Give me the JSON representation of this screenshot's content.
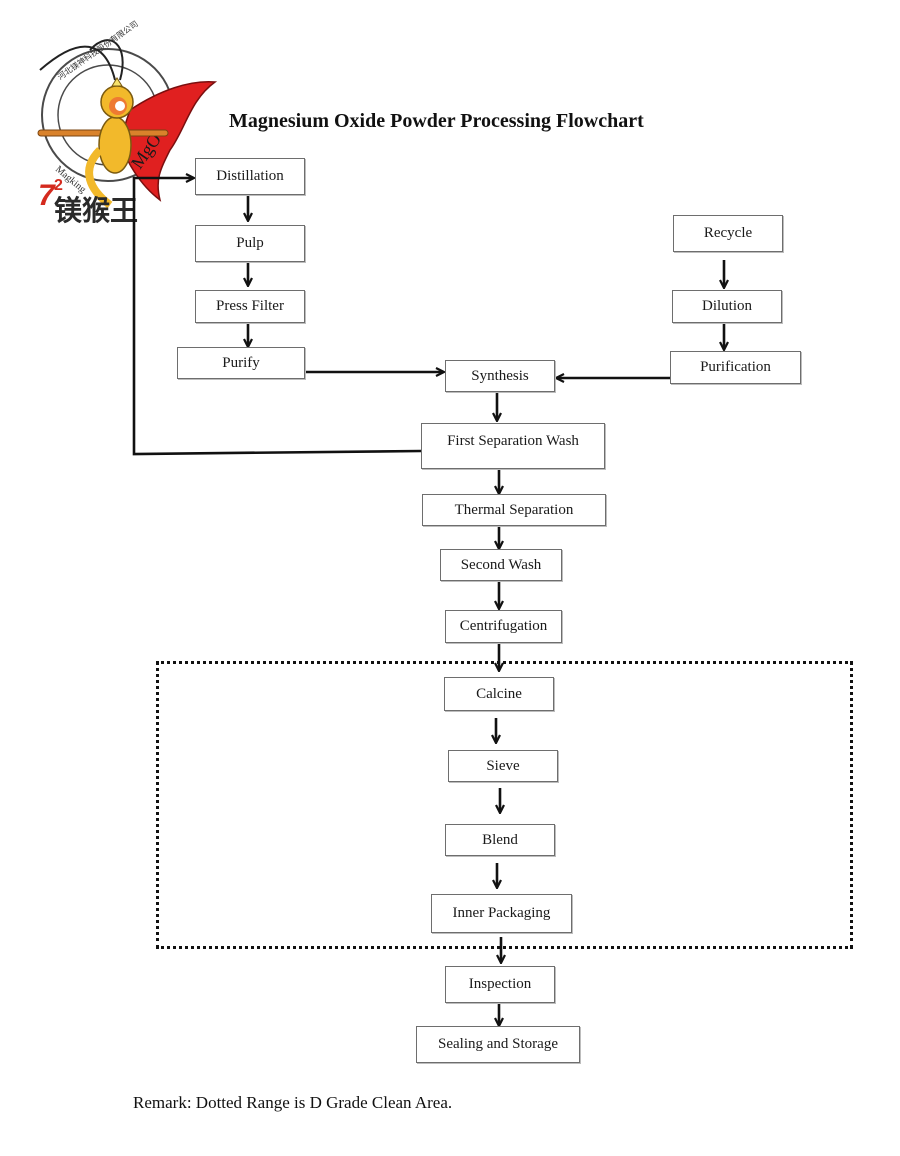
{
  "title": "Magnesium Oxide Powder Processing Flowchart",
  "remark": "Remark: Dotted Range is D Grade Clean Area.",
  "logo": {
    "icon": "monkey-king-logo-icon",
    "ring_text_cn": "河北镁神科技股份有限公司",
    "ring_text_en": "Magking",
    "cape_text": "MgO",
    "badge_number": "72",
    "brand_cn": "镁猴王",
    "colors": {
      "cape": "#e02020",
      "brand_red": "#d42a1e",
      "brand_dark": "#2a2a2a",
      "gold": "#f2b92b"
    }
  },
  "clean_area": {
    "label": "D Grade Clean Area",
    "style": "dotted"
  },
  "nodes": [
    {
      "id": "distillation",
      "label": "Distillation"
    },
    {
      "id": "pulp",
      "label": "Pulp"
    },
    {
      "id": "press_filter",
      "label": "Press Filter"
    },
    {
      "id": "purify",
      "label": "Purify"
    },
    {
      "id": "recycle",
      "label": "Recycle"
    },
    {
      "id": "dilution",
      "label": "Dilution"
    },
    {
      "id": "purification",
      "label": "Purification"
    },
    {
      "id": "synthesis",
      "label": "Synthesis"
    },
    {
      "id": "first_separation_wash",
      "label": "First Separation Wash"
    },
    {
      "id": "thermal_separation",
      "label": "Thermal Separation"
    },
    {
      "id": "second_wash",
      "label": "Second Wash"
    },
    {
      "id": "centrifugation",
      "label": "Centrifugation"
    },
    {
      "id": "calcine",
      "label": "Calcine"
    },
    {
      "id": "sieve",
      "label": "Sieve"
    },
    {
      "id": "blend",
      "label": "Blend"
    },
    {
      "id": "inner_packaging",
      "label": "Inner Packaging"
    },
    {
      "id": "inspection",
      "label": "Inspection"
    },
    {
      "id": "sealing_and_storage",
      "label": "Sealing and Storage"
    }
  ],
  "edges": [
    {
      "from": "distillation",
      "to": "pulp"
    },
    {
      "from": "pulp",
      "to": "press_filter"
    },
    {
      "from": "press_filter",
      "to": "purify"
    },
    {
      "from": "purify",
      "to": "synthesis"
    },
    {
      "from": "recycle",
      "to": "dilution"
    },
    {
      "from": "dilution",
      "to": "purification"
    },
    {
      "from": "purification",
      "to": "synthesis"
    },
    {
      "from": "synthesis",
      "to": "first_separation_wash"
    },
    {
      "from": "first_separation_wash",
      "to": "distillation",
      "type": "feedback-loop"
    },
    {
      "from": "first_separation_wash",
      "to": "thermal_separation"
    },
    {
      "from": "thermal_separation",
      "to": "second_wash"
    },
    {
      "from": "second_wash",
      "to": "centrifugation"
    },
    {
      "from": "centrifugation",
      "to": "calcine"
    },
    {
      "from": "calcine",
      "to": "sieve"
    },
    {
      "from": "sieve",
      "to": "blend"
    },
    {
      "from": "blend",
      "to": "inner_packaging"
    },
    {
      "from": "inner_packaging",
      "to": "inspection"
    },
    {
      "from": "inspection",
      "to": "sealing_and_storage"
    }
  ]
}
